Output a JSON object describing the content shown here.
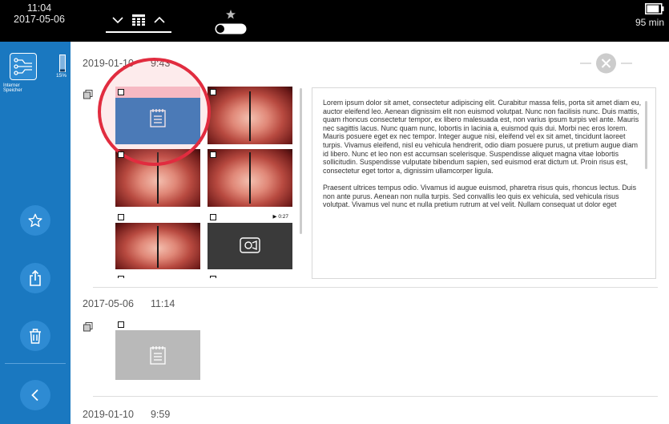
{
  "status_bar": {
    "time": "11:04",
    "date": "2017-05-06",
    "battery_remaining": "95 min",
    "battery_level_fraction": 0.9
  },
  "sidebar": {
    "storage_label": "Interner Speicher",
    "storage_percent": "15%",
    "buttons": [
      "star-icon",
      "share-icon",
      "trash-icon",
      "back-icon"
    ]
  },
  "groups": [
    {
      "date": "2019-01-10",
      "time": "9:43",
      "thumbnails": [
        {
          "type": "note",
          "selected": true
        },
        {
          "type": "image"
        },
        {
          "type": "image"
        },
        {
          "type": "image"
        },
        {
          "type": "image"
        },
        {
          "type": "video",
          "duration": "▶ 0:27"
        }
      ],
      "note_paragraphs": [
        "Lorem ipsum dolor sit amet, consectetur adipiscing elit. Curabitur massa felis, porta sit amet diam eu, auctor eleifend leo. Aenean dignissim elit non euismod volutpat. Nunc non facilisis nunc. Duis mattis, quam rhoncus consectetur tempor, ex libero malesuada est, non varius ipsum turpis vel ante. Mauris nec sagittis lacus. Nunc quam nunc, lobortis in lacinia a, euismod quis dui. Morbi nec eros lorem. Mauris posuere eget ex nec tempor. Integer augue nisi, eleifend vel ex sit amet, tincidunt laoreet turpis. Vivamus eleifend, nisl eu vehicula hendrerit, odio diam posuere purus, ut pretium augue diam id libero. Nunc et leo non est accumsan scelerisque. Suspendisse aliquet magna vitae lobortis sollicitudin. Suspendisse vulputate bibendum sapien, sed euismod erat dictum ut. Proin risus est, consectetur eget tortor a, dignissim ullamcorper ligula.",
        "Praesent ultrices tempus odio. Vivamus id augue euismod, pharetra risus quis, rhoncus lectus. Duis non ante purus. Aenean non nulla turpis. Sed convallis leo quis ex vehicula, sed vehicula risus volutpat. Vivamus vel nunc et nulla pretium rutrum at vel velit. Nullam consequat ut dolor eget"
      ]
    },
    {
      "date": "2017-05-06",
      "time": "11:14",
      "thumbnails": [
        {
          "type": "note"
        }
      ]
    },
    {
      "date": "2019-01-10",
      "time": "9:59"
    }
  ],
  "colors": {
    "sidebar_blue": "#1a78c0",
    "sidebar_button": "#2e8bd3",
    "selected_note": "#2e7bc1",
    "selected_band": "#f7c5cf",
    "highlight_ring": "#e12c3f",
    "unselected_note": "#b9b9b9"
  }
}
